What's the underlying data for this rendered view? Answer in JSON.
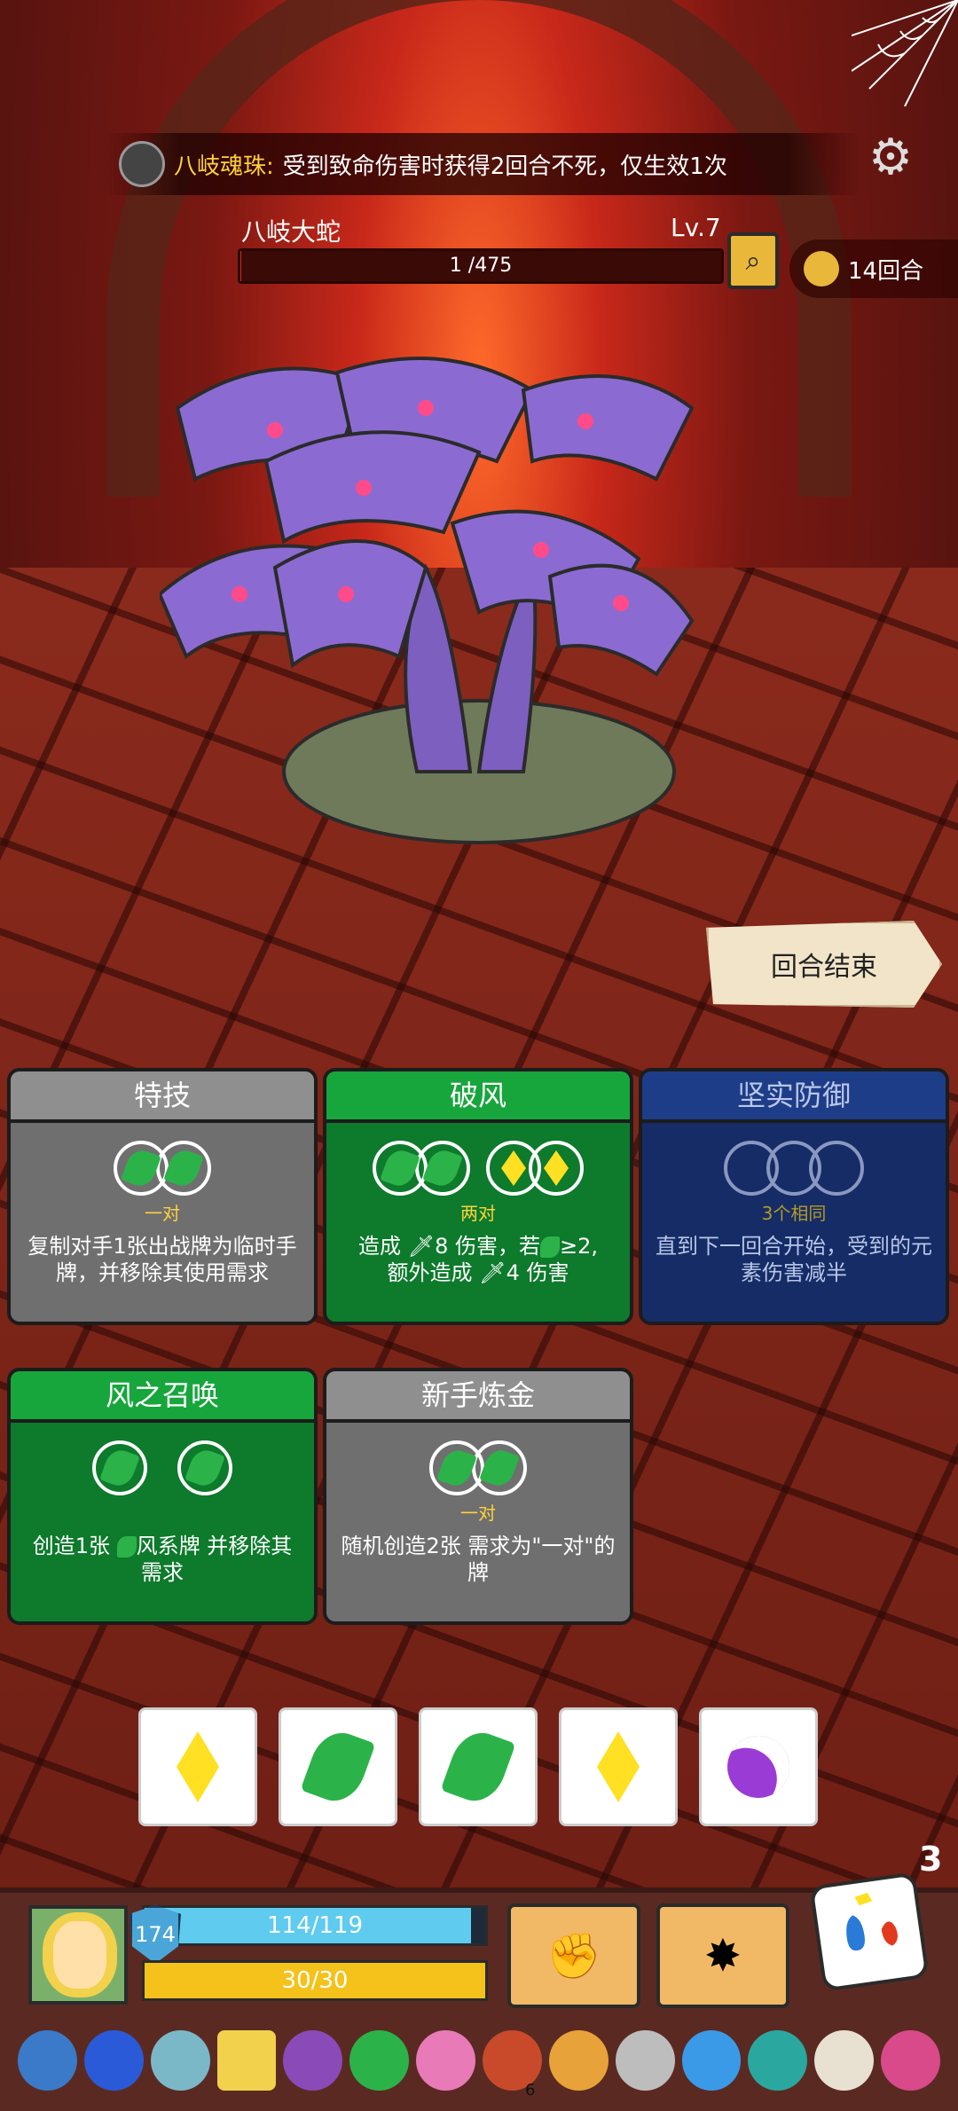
{
  "relic": {
    "name": "八岐魂珠:",
    "effect": "受到致命伤害时获得2回合不死，仅生效1次",
    "icon": "dragon-skull-icon"
  },
  "enemy": {
    "name": "八岐大蛇",
    "level": "Lv.7",
    "hp_text": "1 /475",
    "hp_fraction": 0.0021
  },
  "turn": {
    "label": "14回合",
    "icon": "hourglass-icon"
  },
  "end_turn_label": "回合结束",
  "skills": [
    {
      "title": "特技",
      "requirement": "一对",
      "description": "复制对手1张出战牌为临时手牌，并移除其使用需求"
    },
    {
      "title": "破风",
      "requirement": "两对",
      "description_a": "造成 ",
      "description_b": "8 伤害，若",
      "description_c": "≥2,",
      "description_d": "额外造成 ",
      "description_e": "4 伤害"
    },
    {
      "title": "坚实防御",
      "requirement": "3个相同",
      "description": "直到下一回合开始，受到的元素伤害减半"
    },
    {
      "title": "风之召唤",
      "description_a": "创造1张 ",
      "description_b": "风系牌 并移除其需求"
    },
    {
      "title": "新手炼金",
      "requirement": "一对",
      "description": "随机创造2张 需求为\"一对\"的牌"
    }
  ],
  "hand": [
    "diamond",
    "wind-leaf",
    "wind-leaf",
    "diamond",
    "moon"
  ],
  "player": {
    "shield": "174",
    "hp_text": "114/119",
    "hp_fraction": 0.958,
    "energy_text": "30/30",
    "energy_fraction": 1.0
  },
  "dice_count": "3",
  "relic_bar_count": "6",
  "colors": {
    "wind": "#2bb34a",
    "lightning": "#ffe022",
    "moon": "#9b3bd6",
    "accent_gold": "#ffd23a"
  }
}
